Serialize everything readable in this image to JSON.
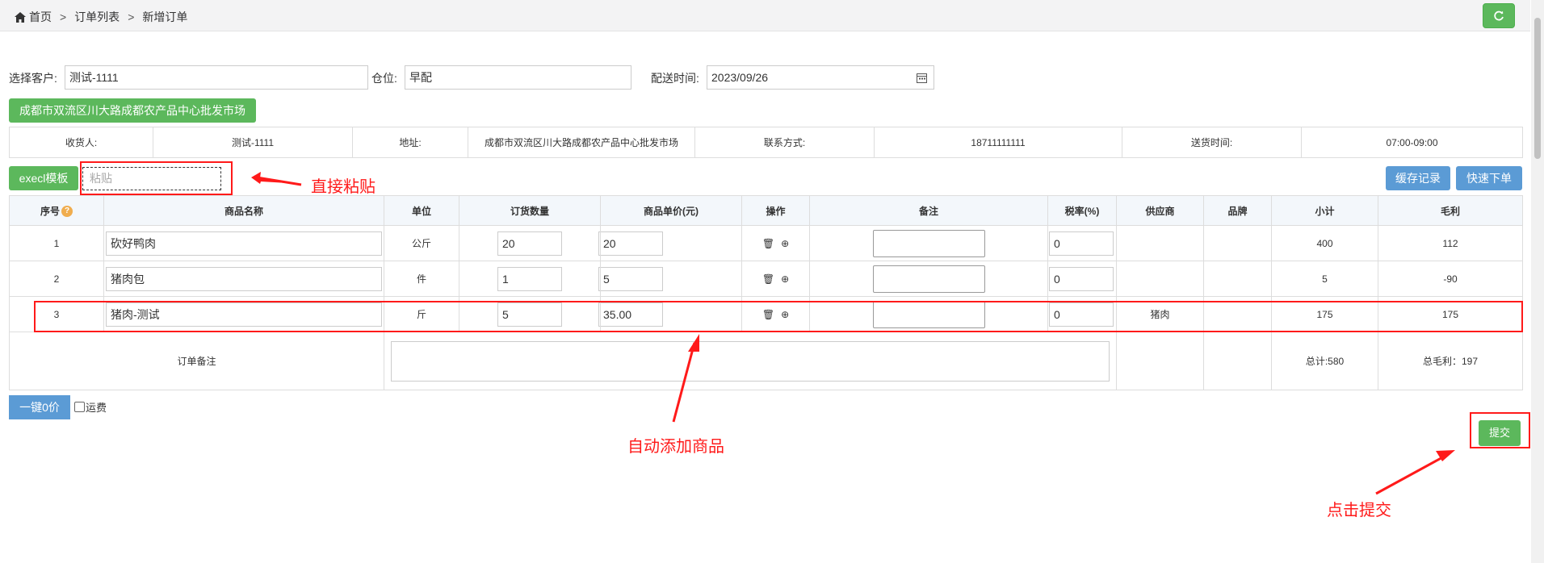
{
  "breadcrumb": {
    "home": "首页",
    "sep1": ">",
    "list": "订单列表",
    "sep2": ">",
    "current": "新增订单"
  },
  "form": {
    "customer_label": "选择客户:",
    "customer_value": "测试-1111",
    "warehouse_label": "仓位:",
    "warehouse_value": "早配",
    "delivery_label": "配送时间:",
    "delivery_value": "2023/09/26"
  },
  "address_button": "成都市双流区川大路成都农产品中心批发市场",
  "info": {
    "receiver_label": "收货人:",
    "receiver_value": "测试-1111",
    "address_label": "地址:",
    "address_value": "成都市双流区川大路成都农产品中心批发市场",
    "contact_label": "联系方式:",
    "contact_value": "18711111111",
    "time_label": "送货时间:",
    "time_value": "07:00-09:00"
  },
  "toolbar": {
    "excel_template": "execl模板",
    "paste_placeholder": "粘贴",
    "cache_records": "缓存记录",
    "quick_order": "快速下单"
  },
  "columns": [
    "序号",
    "商品名称",
    "单位",
    "订货数量",
    "商品单价(元)",
    "操作",
    "备注",
    "税率(%)",
    "供应商",
    "品牌",
    "小计",
    "毛利"
  ],
  "rows": [
    {
      "no": "1",
      "name": "砍好鸭肉",
      "unit": "公斤",
      "qty": "20",
      "price": "20",
      "tax": "0",
      "supplier": "",
      "brand": "",
      "subtotal": "400",
      "profit": "112"
    },
    {
      "no": "2",
      "name": "猪肉包",
      "unit": "件",
      "qty": "1",
      "price": "5",
      "tax": "0",
      "supplier": "",
      "brand": "",
      "subtotal": "5",
      "profit": "-90"
    },
    {
      "no": "3",
      "name": "猪肉-测试",
      "unit": "斤",
      "qty": "5",
      "price": "35.00",
      "tax": "0",
      "supplier": "猪肉",
      "brand": "",
      "subtotal": "175",
      "profit": "175"
    }
  ],
  "summary": {
    "remark_label": "订单备注",
    "total": "总计:580",
    "total_profit": "总毛利：197"
  },
  "bottom": {
    "zero_price": "一键0价",
    "freight": "运费",
    "submit": "提交"
  },
  "annotations": {
    "paste": "直接粘贴",
    "auto_add": "自动添加商品",
    "click_submit": "点击提交"
  },
  "colors": {
    "green": "#5cb85c",
    "blue": "#5b9bd5",
    "red_annotation": "#ff1a1a"
  }
}
